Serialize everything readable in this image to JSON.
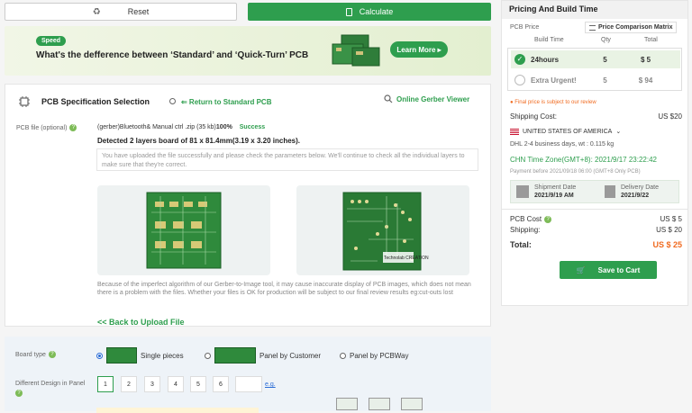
{
  "top_buttons": {
    "reset": "Reset",
    "calculate": "Calculate"
  },
  "banner": {
    "tag": "Speed",
    "title": "What's the defference between ‘Standard’ and ‘Quick-Turn’ PCB",
    "button": "Learn More ▸"
  },
  "spec": {
    "title": "PCB Specification Selection",
    "return_link": "⇐ Return to Standard PCB",
    "gerber_link": "Online Gerber Viewer",
    "file_label": "PCB file (optional)",
    "file_name": "(gerber)Bluetooth& Manual ctrl .zip (35 kb)",
    "file_pct": "100%",
    "file_status": "Success",
    "detected": "Detected 2 layers board of 81 x 81.4mm(3.19 x 3.20 inches).",
    "note": "You have uploaded the file successfully and please check the parameters below. We'll continue to check all the individual layers to make sure that they're correct.",
    "disclaimer": "Because of the imperfect algorithm of our Gerber-to-Image tool, it may cause inaccurate display of PCB images, which does not mean there is a problem with the files. Whether your files is OK for production will be subject to our final review results eg:cut-outs lost",
    "back_link": "<< Back to Upload File",
    "silkscreen_text": "Technolab CREATION"
  },
  "board": {
    "type_label": "Board type",
    "options": [
      "Single pieces",
      "Panel by Customer",
      "Panel by PCBWay"
    ],
    "design_label": "Different Design in Panel",
    "design_values": [
      "1",
      "2",
      "3",
      "4",
      "5",
      "6"
    ],
    "eg": "e.g."
  },
  "pricing": {
    "header": "Pricing And Build Time",
    "pcb_price": "PCB Price",
    "compare": "Price Comparison Matrix",
    "cols": [
      "Build Time",
      "Qty",
      "Total"
    ],
    "rows": [
      {
        "time": "24hours",
        "qty": "5",
        "total": "$ 5"
      },
      {
        "time": "Extra Urgent!",
        "qty": "5",
        "total": "$ 94"
      }
    ],
    "final_note": "Final price is subject to our review",
    "shipping_cost_label": "Shipping Cost:",
    "shipping_cost": "US $20",
    "country": "UNITED STATES OF AMERICA",
    "dhl": "DHL",
    "dhl_days": "2-4 business days,",
    "dhl_wt": "wt : 0.115 kg",
    "tz": "CHN Time Zone(GMT+8): 2021/9/17 23:22:42",
    "payment_note": "Payment before 2021/09/18 06:00 (GMT+8 Only PCB)",
    "ship_date_label": "Shipment Date",
    "ship_date": "2021/9/19 AM",
    "delivery_label": "Delivery Date",
    "delivery": "2021/9/22",
    "pcb_cost_label": "PCB Cost",
    "pcb_cost": "US $ 5",
    "shipping_label": "Shipping:",
    "shipping": "US $ 20",
    "total_label": "Total:",
    "total": "US $ 25",
    "cart": "Save to Cart",
    "accent": "#2e9e4e",
    "total_color": "#f06a1f"
  }
}
